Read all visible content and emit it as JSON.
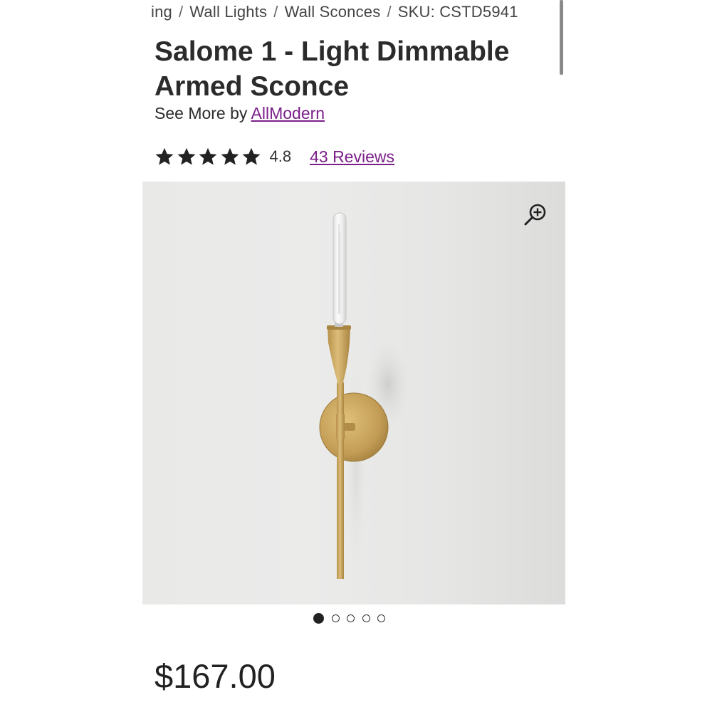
{
  "breadcrumb": {
    "items": [
      "ing",
      "Wall Lights",
      "Wall Sconces"
    ],
    "separator": "/",
    "sku": "SKU: CSTD5941"
  },
  "product": {
    "title": "Salome 1 - Light Dimmable Armed Sconce",
    "brand_prefix": "See More by",
    "brand_name": "AllModern",
    "rating": "4.8",
    "star_count": 5,
    "reviews_label": "43 Reviews",
    "price": "$167.00"
  },
  "gallery": {
    "image_count": 5,
    "active_index": 0,
    "zoom_icon": "zoom-in-icon"
  },
  "colors": {
    "link": "#7b1f8a",
    "text": "#222222",
    "star": "#222222",
    "brass": "#c9a55c"
  }
}
